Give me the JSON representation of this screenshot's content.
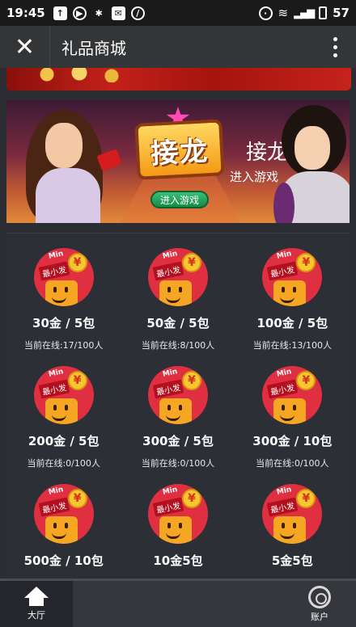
{
  "status_bar": {
    "time": "19:45",
    "battery": "57"
  },
  "title_bar": {
    "title": "礼品商城"
  },
  "banner": {
    "logo_text": "接龙",
    "title": "接龙",
    "subtitle": "进入游戏",
    "button_label": "进入游戏"
  },
  "badge": {
    "min_text": "Min",
    "tag_text": "最小发",
    "coin_symbol": "¥"
  },
  "products": [
    {
      "price": "30金 / 5包",
      "online": "当前在线:17/100人"
    },
    {
      "price": "50金 / 5包",
      "online": "当前在线:8/100人"
    },
    {
      "price": "100金 / 5包",
      "online": "当前在线:13/100人"
    },
    {
      "price": "200金 / 5包",
      "online": "当前在线:0/100人"
    },
    {
      "price": "300金 / 5包",
      "online": "当前在线:0/100人"
    },
    {
      "price": "300金 / 10包",
      "online": "当前在线:0/100人"
    },
    {
      "price": "500金 / 10包",
      "online": ""
    },
    {
      "price": "10金5包",
      "online": ""
    },
    {
      "price": "5金5包",
      "online": ""
    }
  ],
  "bottom_nav": {
    "home_label": "大厅",
    "account_label": "账户"
  },
  "colors": {
    "badge_red": "#e02f41",
    "coin_gold": "#f7c631",
    "bag_orange": "#f5a623",
    "panel_bg": "#2d2f36"
  }
}
